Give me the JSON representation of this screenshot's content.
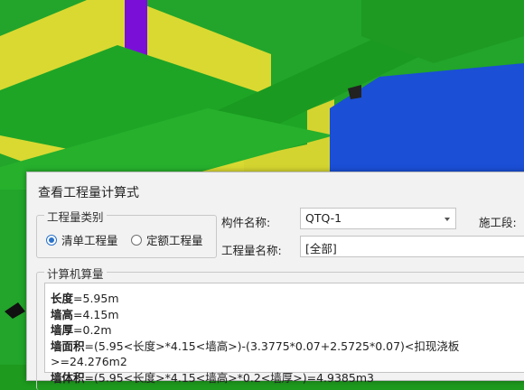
{
  "dialog": {
    "title": "查看工程量计算式",
    "quantity_type": {
      "group_label": "工程量类别",
      "options": [
        {
          "label": "清单工程量",
          "selected": true
        },
        {
          "label": "定额工程量",
          "selected": false
        }
      ]
    },
    "component_name": {
      "label": "构件名称:",
      "value": "QTQ-1"
    },
    "construction_stage": {
      "label": "施工段:"
    },
    "quantity_name": {
      "label": "工程量名称:",
      "value": "[全部]"
    },
    "calc": {
      "group_label": "计算机算量",
      "lines": [
        {
          "key": "长度",
          "rest": "=5.95m"
        },
        {
          "key": "墙高",
          "rest": "=4.15m"
        },
        {
          "key": "墙厚",
          "rest": "=0.2m"
        },
        {
          "key": "墙面积",
          "rest": "=(5.95<长度>*4.15<墙高>)-(3.3775*0.07+2.5725*0.07)<扣现浇板>=24.276m2"
        },
        {
          "key": "墙体积",
          "rest": "=(5.95<长度>*4.15<墙高>*0.2<墙厚>)=4.9385m3"
        }
      ]
    }
  },
  "colors": {
    "green": "#22a52a",
    "green_dark": "#168a1c",
    "yellow": "#d9d932",
    "blue": "#1a4fd6",
    "purple": "#7a10d8",
    "accent": "#2a72c9"
  }
}
